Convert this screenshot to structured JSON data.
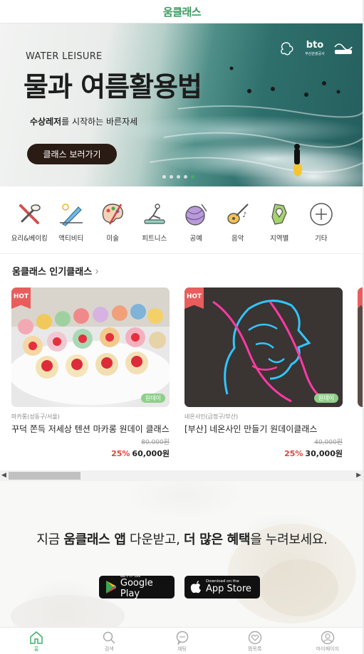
{
  "header": {
    "logo": "움클래스"
  },
  "banner": {
    "subtitle": "WATER LEISURE",
    "title": "물과 여름활용법",
    "desc_strong": "수상레저",
    "desc_rest": "를 시작하는 바른자세",
    "button": "클래스 보러가기",
    "logos": [
      "bto",
      "부산관광공사"
    ],
    "slide_count": 5,
    "active_slide": 5
  },
  "categories": [
    {
      "label": "요리&베이킹",
      "icon": "cooking-icon"
    },
    {
      "label": "액티비티",
      "icon": "activity-icon"
    },
    {
      "label": "미술",
      "icon": "art-palette-icon"
    },
    {
      "label": "피트니스",
      "icon": "fitness-icon"
    },
    {
      "label": "공예",
      "icon": "craft-yarn-icon"
    },
    {
      "label": "음악",
      "icon": "music-guitar-icon"
    },
    {
      "label": "지역별",
      "icon": "region-map-icon"
    },
    {
      "label": "기타",
      "icon": "plus-circle-icon"
    }
  ],
  "popular": {
    "title": "움클래스 인기클래스",
    "items": [
      {
        "badge": "HOT",
        "tag": "원데이",
        "category": "마카롱(성동구/서울)",
        "title": "꾸덕 쫀득 저세상 텐션 마카롱 원데이 클래스",
        "original_price": "80,000원",
        "discount": "25%",
        "price": "60,000원"
      },
      {
        "badge": "HOT",
        "tag": "원데이",
        "category": "네온사인(금정구/부산)",
        "title": "[부산] 네온사인 만들기 원데이클래스",
        "original_price": "40,000원",
        "discount": "25%",
        "price": "30,000원"
      }
    ]
  },
  "promo": {
    "pre": "지금 ",
    "strong1": "움클래스 앱",
    "mid": " 다운받고, ",
    "strong2": "더 많은 혜택",
    "post": "을 누려보세요.",
    "google_small": "GET IT ON",
    "google_big": "Google Play",
    "apple_small": "Download on the",
    "apple_big": "App Store"
  },
  "tabs": [
    {
      "label": "홈",
      "icon": "home-icon"
    },
    {
      "label": "검색",
      "icon": "search-icon"
    },
    {
      "label": "채팅",
      "icon": "chat-icon"
    },
    {
      "label": "찜목록",
      "icon": "heart-icon"
    },
    {
      "label": "마이페이지",
      "icon": "user-icon"
    }
  ],
  "colors": {
    "brand": "#3fae6a",
    "hot": "#e95d5d",
    "discount": "#e4433c"
  }
}
